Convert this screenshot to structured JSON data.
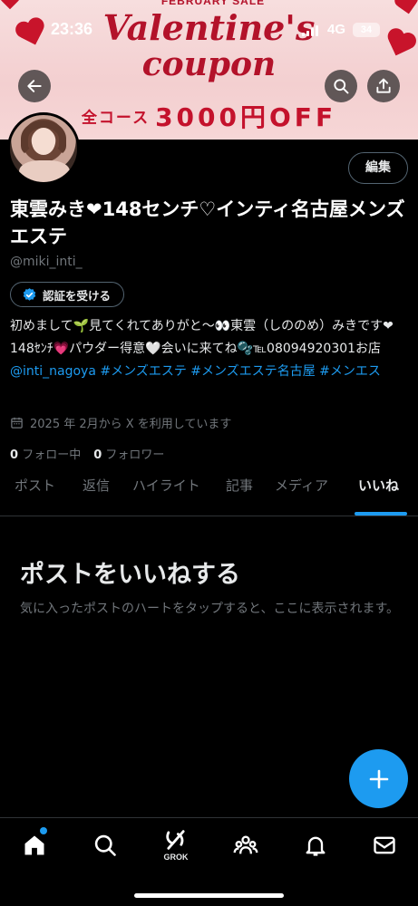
{
  "status_bar": {
    "time": "23:36",
    "network": "4G",
    "battery": "34"
  },
  "banner": {
    "top_text": "FEBRUARY SALE",
    "title_line1": "Valentine's",
    "title_line2": "coupon",
    "sub_left": "全コース",
    "sub_right": "3000円OFF",
    "accent_color": "#c4122c"
  },
  "header": {
    "back_icon": "arrow-left-icon",
    "search_icon": "search-icon",
    "share_icon": "share-icon"
  },
  "profile": {
    "edit_label": "編集",
    "name": "東雲みき❤148センチ♡インティ名古屋メンズエステ",
    "handle": "@miki_inti_",
    "verify_label": "認証を受ける",
    "bio_text": "初めまして🌱見てくれてありがと〜👀東雲（しののめ）みきです❤ 148ｾﾝﾁ💗パウダー得意🤍会いに来てね🫧℡08094920301お店 ",
    "bio_mention": "@inti_nagoya",
    "bio_tags": " #メンズエステ #メンズエステ名古屋 #メンエス",
    "joined": "2025 年 2月から X を利用しています",
    "following_count": "0",
    "following_label": "フォロー中",
    "followers_count": "0",
    "followers_label": "フォロワー"
  },
  "tabs": [
    {
      "label": "ポスト",
      "active": false
    },
    {
      "label": "返信",
      "active": false
    },
    {
      "label": "ハイライト",
      "active": false
    },
    {
      "label": "記事",
      "active": false
    },
    {
      "label": "メディア",
      "active": false
    },
    {
      "label": "いいね",
      "active": true
    }
  ],
  "empty_state": {
    "title": "ポストをいいねする",
    "description": "気に入ったポストのハートをタップすると、ここに表示されます。"
  },
  "fab_icon": "plus-icon",
  "bottom_nav": {
    "items": [
      "home-icon",
      "search-icon",
      "grok-icon",
      "communities-icon",
      "notifications-icon",
      "messages-icon"
    ],
    "grok_label": "GROK",
    "accent_color": "#1d9bf0"
  }
}
